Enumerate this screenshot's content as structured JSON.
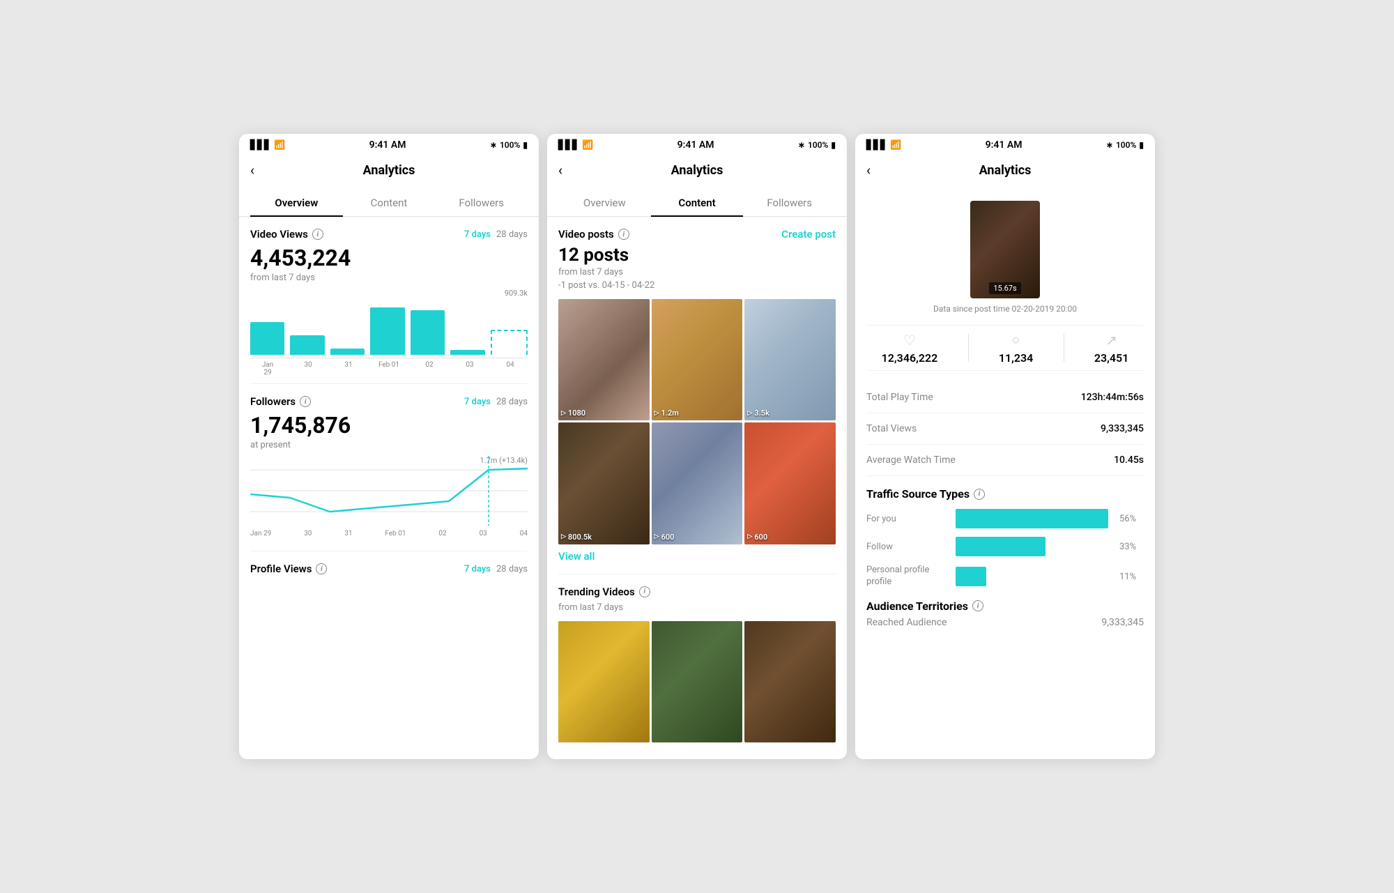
{
  "screens": [
    {
      "id": "screen1",
      "statusBar": {
        "time": "9:41 AM",
        "battery": "100%"
      },
      "header": {
        "back": "‹",
        "title": "Analytics"
      },
      "tabs": [
        {
          "label": "Overview",
          "active": true
        },
        {
          "label": "Content",
          "active": false
        },
        {
          "label": "Followers",
          "active": false
        }
      ],
      "videoViews": {
        "title": "Video Views",
        "period7": "7 days",
        "period28": "28 days",
        "value": "4,453,224",
        "subtext": "from last 7 days",
        "chartLabelTop": "909.3k",
        "bars": [
          50,
          30,
          10,
          72,
          68,
          8,
          38
        ],
        "barLabels": [
          "Jan 29",
          "30",
          "31",
          "Feb 01",
          "02",
          "03",
          "04"
        ],
        "lastBarDashed": true
      },
      "followers": {
        "title": "Followers",
        "period7": "7 days",
        "period28": "28 days",
        "value": "1,745,876",
        "subtext": "at present",
        "chartLabelTop": "1.7m (+13.4k)",
        "xLabels": [
          "Jan 29",
          "30",
          "31",
          "Feb 01",
          "02",
          "03",
          "04"
        ]
      },
      "profileViews": {
        "title": "Profile Views",
        "period7": "7 days",
        "period28": "28 days"
      }
    },
    {
      "id": "screen2",
      "statusBar": {
        "time": "9:41 AM",
        "battery": "100%"
      },
      "header": {
        "back": "‹",
        "title": "Analytics"
      },
      "tabs": [
        {
          "label": "Overview",
          "active": false
        },
        {
          "label": "Content",
          "active": true
        },
        {
          "label": "Followers",
          "active": false
        }
      ],
      "videoPosts": {
        "title": "Video posts",
        "count": "12 posts",
        "subtext": "from last 7 days",
        "subtext2": "-1 post vs. 04-15 - 04-22",
        "createPost": "Create post",
        "videos": [
          {
            "views": "1080",
            "type": "city"
          },
          {
            "views": "1.2m",
            "type": "food"
          },
          {
            "views": "3.5k",
            "type": "winter"
          },
          {
            "views": "800.5k",
            "type": "corridor"
          },
          {
            "views": "600",
            "type": "venice"
          },
          {
            "views": "600",
            "type": "cafe"
          }
        ],
        "viewAll": "View all"
      },
      "trendingVideos": {
        "title": "Trending Videos",
        "subtext": "from last 7 days",
        "thumbs": [
          {
            "type": "fries"
          },
          {
            "type": "deer"
          },
          {
            "type": "arch"
          }
        ]
      }
    },
    {
      "id": "screen3",
      "statusBar": {
        "time": "9:41 AM",
        "battery": "100%"
      },
      "header": {
        "back": "‹",
        "title": "Analytics"
      },
      "postThumb": {
        "duration": "15.67s"
      },
      "dataSince": "Data since post time 02-20-2019 20:00",
      "stats": {
        "likes": "12,346,222",
        "comments": "11,234",
        "shares": "23,451"
      },
      "metrics": [
        {
          "label": "Total Play Time",
          "value": "123h:44m:56s"
        },
        {
          "label": "Total Views",
          "value": "9,333,345"
        },
        {
          "label": "Average Watch Time",
          "value": "10.45s"
        }
      ],
      "trafficSources": {
        "title": "Traffic Source Types",
        "sources": [
          {
            "label": "For you",
            "pct": 56,
            "display": "56%"
          },
          {
            "label": "Follow",
            "pct": 33,
            "display": "33%"
          },
          {
            "label": "Personal profile\nprofile",
            "pct": 11,
            "display": "11%"
          }
        ]
      },
      "audienceTerritories": {
        "title": "Audience Territories",
        "subtitle": "Reached Audience",
        "value": "9,333,345"
      }
    }
  ]
}
